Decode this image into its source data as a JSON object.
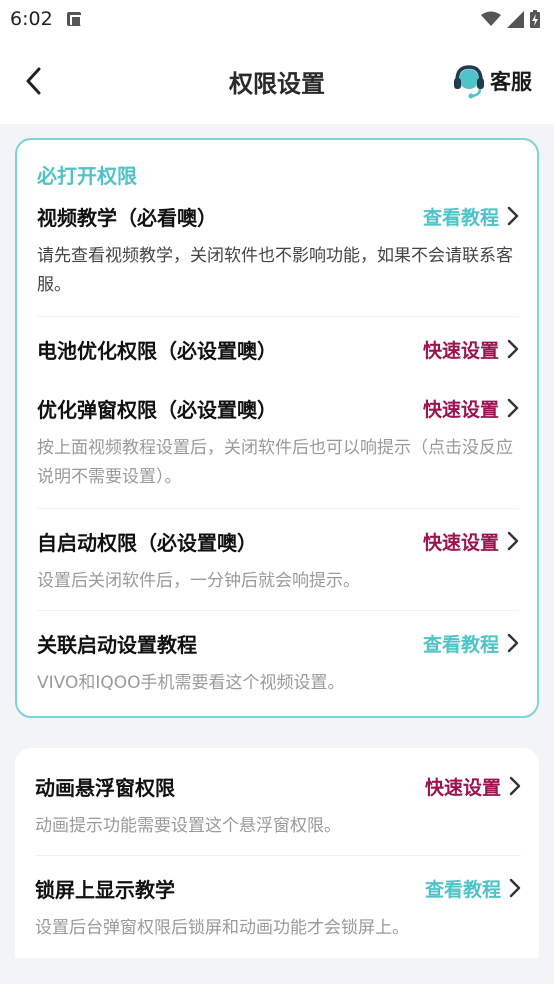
{
  "status_bar": {
    "time": "6:02",
    "icons": [
      "notification-a-icon",
      "wifi-icon",
      "signal-icon",
      "battery-charging-icon"
    ]
  },
  "header": {
    "title": "权限设置",
    "customer_service": "客服",
    "icons": [
      "back-arrow-icon",
      "headset-icon"
    ]
  },
  "colors": {
    "accent_teal": "#4fc3c7",
    "accent_magenta": "#9a1452",
    "card_border": "#7dd3d8",
    "background": "#f3f4f6"
  },
  "card1": {
    "section_title": "必打开权限",
    "rows": [
      {
        "title": "视频教学（必看噢）",
        "action": "查看教程",
        "desc": "请先查看视频教学，关闭软件也不影响功能，如果不会请联系客服。"
      },
      {
        "title": "电池优化权限（必设置噢）",
        "action": "快速设置",
        "desc": ""
      },
      {
        "title": "优化弹窗权限（必设置噢）",
        "action": "快速设置",
        "desc": "按上面视频教程设置后，关闭软件后也可以响提示（点击没反应说明不需要设置）。"
      },
      {
        "title": "自启动权限（必设置噢）",
        "action": "快速设置",
        "desc": "设置后关闭软件后，一分钟后就会响提示。"
      },
      {
        "title": "关联启动设置教程",
        "action": "查看教程",
        "desc": "VIVO和IQOO手机需要看这个视频设置。"
      }
    ]
  },
  "card2": {
    "rows": [
      {
        "title": "动画悬浮窗权限",
        "action": "快速设置",
        "desc": "动画提示功能需要设置这个悬浮窗权限。"
      },
      {
        "title": "锁屏上显示教学",
        "action": "查看教程",
        "desc": "设置后台弹窗权限后锁屏和动画功能才会锁屏上。"
      }
    ]
  }
}
